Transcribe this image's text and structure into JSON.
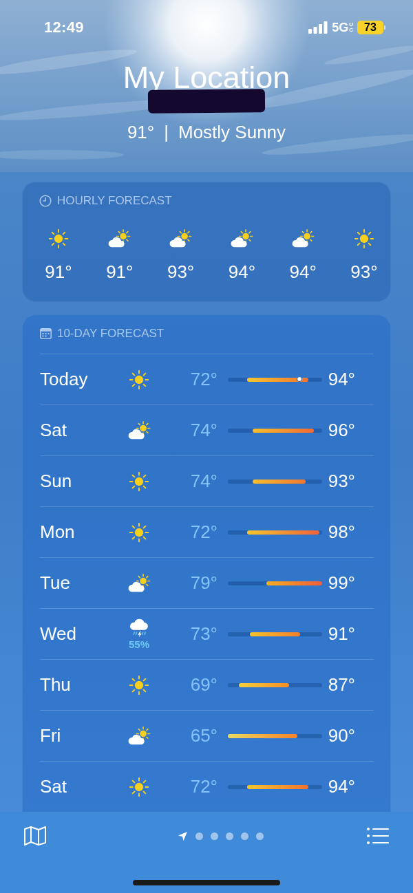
{
  "status_bar": {
    "time": "12:49",
    "network": "5G",
    "network_suffix": [
      "U",
      "C"
    ],
    "battery": "73",
    "low_power_mode": true
  },
  "header": {
    "location": "My Location",
    "location_redacted": true,
    "temperature": "91°",
    "separator": "|",
    "condition": "Mostly Sunny"
  },
  "hourly_forecast": {
    "title": "HOURLY FORECAST",
    "hours": [
      {
        "kind": "sunny",
        "temp": "91°"
      },
      {
        "kind": "partly_cloudy",
        "temp": "91°"
      },
      {
        "kind": "partly_cloudy",
        "temp": "93°"
      },
      {
        "kind": "partly_cloudy",
        "temp": "94°"
      },
      {
        "kind": "partly_cloudy",
        "temp": "94°"
      },
      {
        "kind": "sunny",
        "temp": "93°"
      }
    ]
  },
  "daily_forecast": {
    "title": "10-DAY FORECAST",
    "days": [
      {
        "day": "Today",
        "kind": "sunny",
        "low": "72°",
        "high": "94°",
        "current": true
      },
      {
        "day": "Sat",
        "kind": "partly_cloudy",
        "low": "74°",
        "high": "96°",
        "current": false
      },
      {
        "day": "Sun",
        "kind": "sunny",
        "low": "74°",
        "high": "93°",
        "current": false
      },
      {
        "day": "Mon",
        "kind": "sunny",
        "low": "72°",
        "high": "98°",
        "current": false
      },
      {
        "day": "Tue",
        "kind": "partly_cloudy",
        "low": "79°",
        "high": "99°",
        "current": false
      },
      {
        "day": "Wed",
        "kind": "thunderstorm",
        "precipitation": "55%",
        "low": "73°",
        "high": "91°",
        "current": false
      },
      {
        "day": "Thu",
        "kind": "sunny",
        "low": "69°",
        "high": "87°",
        "current": false
      },
      {
        "day": "Fri",
        "kind": "partly_cloudy",
        "low": "65°",
        "high": "90°",
        "current": false
      },
      {
        "day": "Sat",
        "kind": "sunny",
        "low": "72°",
        "high": "94°",
        "current": false
      }
    ]
  },
  "bottom_bar": {
    "pages": [
      {
        "kind": "location",
        "selected": true
      },
      {
        "kind": "city",
        "selected": false
      },
      {
        "kind": "city",
        "selected": false
      },
      {
        "kind": "city",
        "selected": false
      },
      {
        "kind": "city",
        "selected": false
      },
      {
        "kind": "city",
        "selected": false
      }
    ]
  }
}
